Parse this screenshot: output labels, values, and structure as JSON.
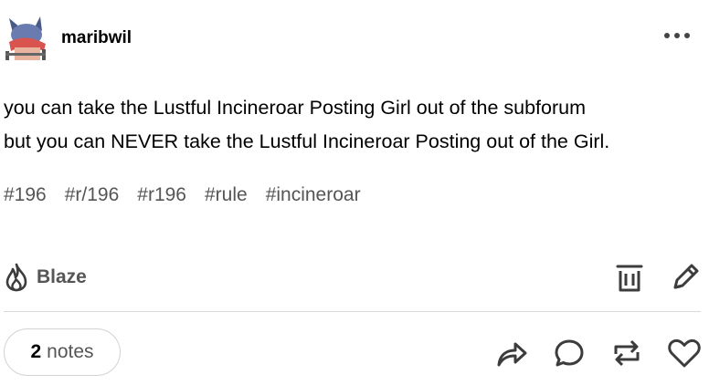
{
  "post": {
    "username": "maribwil",
    "text": "you can take the Lustful Incineroar Posting Girl out of the subforum\nbut you can NEVER take the Lustful Incineroar Posting out of the Girl.",
    "tags": [
      "#196",
      "#r/196",
      "#r196",
      "#rule",
      "#incineroar"
    ]
  },
  "actions": {
    "blaze_label": "Blaze",
    "notes_count": "2",
    "notes_label": "notes"
  },
  "icons": {
    "more": "more-horizontal-icon",
    "blaze": "flame-icon",
    "delete": "trash-icon",
    "edit": "pencil-icon",
    "share": "share-arrow-icon",
    "reply": "speech-bubble-icon",
    "reblog": "reblog-icon",
    "like": "heart-icon"
  },
  "colors": {
    "text": "#000000",
    "muted": "#555555",
    "icon": "#3c3c3c",
    "divider": "#d9d9d9"
  }
}
